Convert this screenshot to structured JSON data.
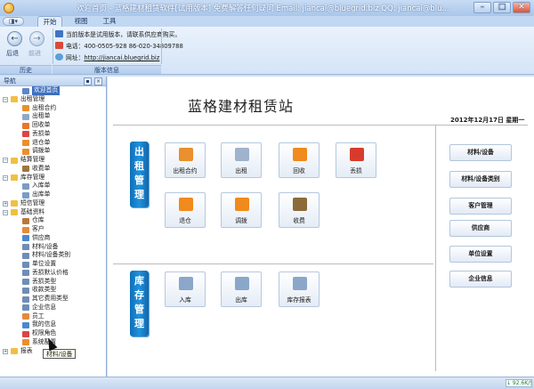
{
  "window": {
    "title": "欢迎首页 - 蓝格建材租赁软件[试用版本] 免费解答任何疑问 Email: jiancai@bluegrid.biz QQ: jiancai@blu...",
    "minimize": "–",
    "maximize": "□",
    "close": "✕"
  },
  "ribbon": {
    "quick_access": "◨▾",
    "tabs": [
      "开始",
      "视图",
      "工具"
    ],
    "active_tab": "开始",
    "history": {
      "back": "后退",
      "forward": "前进",
      "caption": "历史"
    },
    "info": {
      "notice": "当前版本是试用版本，请联系供应商购买。",
      "phone": "电话：400-0505-928  86-020-34809788",
      "website_label": "网址：",
      "website": "http://jiancai.bluegrid.biz",
      "caption": "版本信息"
    }
  },
  "sidebar": {
    "title": "导航",
    "tree": [
      {
        "label": "欢迎首页",
        "level": 1,
        "icon": "home-icon",
        "color": "#5d86c8",
        "selected": true
      },
      {
        "label": "出租管理",
        "level": 0,
        "icon": "folder-icon",
        "color": "#f0c040",
        "expanded": true
      },
      {
        "label": "出租合约",
        "level": 1,
        "icon": "contract-icon",
        "color": "#e98f2d"
      },
      {
        "label": "出租单",
        "level": 1,
        "icon": "document-icon",
        "color": "#8fa9c9"
      },
      {
        "label": "回收单",
        "level": 1,
        "icon": "recycle-icon",
        "color": "#e7782c"
      },
      {
        "label": "丢损单",
        "level": 1,
        "icon": "damage-icon",
        "color": "#d44"
      },
      {
        "label": "退仓单",
        "level": 1,
        "icon": "return-icon",
        "color": "#e98f2d"
      },
      {
        "label": "调拨单",
        "level": 1,
        "icon": "transfer-icon",
        "color": "#e98f2d"
      },
      {
        "label": "结算管理",
        "level": 0,
        "icon": "folder-icon",
        "color": "#f0c040",
        "expanded": true
      },
      {
        "label": "收费单",
        "level": 1,
        "icon": "moneybag-icon",
        "color": "#a0743a"
      },
      {
        "label": "库存管理",
        "level": 0,
        "icon": "folder-icon",
        "color": "#f0c040",
        "expanded": true
      },
      {
        "label": "入库单",
        "level": 1,
        "icon": "stock-in-icon",
        "color": "#7c9cc4"
      },
      {
        "label": "出库单",
        "level": 1,
        "icon": "stock-out-icon",
        "color": "#7c9cc4"
      },
      {
        "label": "短信管理",
        "level": 0,
        "icon": "folder-icon",
        "color": "#f0c040",
        "expanded": false
      },
      {
        "label": "基础资料",
        "level": 0,
        "icon": "folder-icon",
        "color": "#f0c040",
        "expanded": true
      },
      {
        "label": "仓库",
        "level": 1,
        "icon": "warehouse-icon",
        "color": "#b7793b"
      },
      {
        "label": "客户",
        "level": 1,
        "icon": "customer-icon",
        "color": "#e58a3a"
      },
      {
        "label": "供应商",
        "level": 1,
        "icon": "supplier-icon",
        "color": "#4a88cf"
      },
      {
        "label": "材料/设备",
        "level": 1,
        "icon": "material-icon",
        "color": "#6f8db6"
      },
      {
        "label": "材料/设备类别",
        "level": 1,
        "icon": "category-icon",
        "color": "#6f8db6"
      },
      {
        "label": "单位设置",
        "level": 1,
        "icon": "unit-icon",
        "color": "#6f8db6"
      },
      {
        "label": "丢损默认价格",
        "level": 1,
        "icon": "price-icon",
        "color": "#6f8db6"
      },
      {
        "label": "丢损类型",
        "level": 1,
        "icon": "type-icon",
        "color": "#6f8db6"
      },
      {
        "label": "收款类型",
        "level": 1,
        "icon": "type-icon",
        "color": "#6f8db6"
      },
      {
        "label": "其它费用类型",
        "level": 1,
        "icon": "type-icon",
        "color": "#6f8db6"
      },
      {
        "label": "企业信息",
        "level": 1,
        "icon": "company-icon",
        "color": "#6f8db6"
      },
      {
        "label": "员工",
        "level": 1,
        "icon": "employee-icon",
        "color": "#e58a3a"
      },
      {
        "label": "我的信息",
        "level": 1,
        "icon": "profile-icon",
        "color": "#4a88cf"
      },
      {
        "label": "权限角色",
        "level": 1,
        "icon": "role-icon",
        "color": "#d44"
      },
      {
        "label": "系统配置",
        "level": 1,
        "icon": "settings-icon",
        "color": "#e98f2d"
      },
      {
        "label": "报表",
        "level": 0,
        "icon": "folder-icon",
        "color": "#f0c040",
        "expanded": false
      }
    ],
    "tooltip": "材料/设备"
  },
  "main": {
    "title": "蓝格建材租赁站",
    "date": "2012年12月17日 星期一",
    "rental_section": "出租管理",
    "inventory_section": "库存管理",
    "rental_tiles": [
      {
        "label": "出租合约",
        "icon": "contract-icon",
        "color": "#e98f2d"
      },
      {
        "label": "出租",
        "icon": "rent-icon",
        "color": "#9fb3cc"
      },
      {
        "label": "回收",
        "icon": "recycle-icon",
        "color": "#f08a1c"
      },
      {
        "label": "丢损",
        "icon": "damage-icon",
        "color": "#d83b2b"
      },
      {
        "label": "退仓",
        "icon": "return-icon",
        "color": "#f08a1c"
      },
      {
        "label": "调拨",
        "icon": "transfer-icon",
        "color": "#f08a1c"
      },
      {
        "label": "收费",
        "icon": "moneybag-icon",
        "color": "#8c6a3a"
      }
    ],
    "inventory_tiles": [
      {
        "label": "入库",
        "icon": "stock-in-icon",
        "color": "#8aa7ca"
      },
      {
        "label": "出库",
        "icon": "stock-out-icon",
        "color": "#8aa7ca"
      },
      {
        "label": "库存报表",
        "icon": "report-icon",
        "color": "#8aa7ca"
      }
    ],
    "right_buttons": [
      "材料/设备",
      "材料/设备类别",
      "客户管理",
      "供应商",
      "单位设置",
      "企业信息"
    ]
  },
  "statusbar": {
    "speed": "↓ 92.6K/S ↑"
  }
}
